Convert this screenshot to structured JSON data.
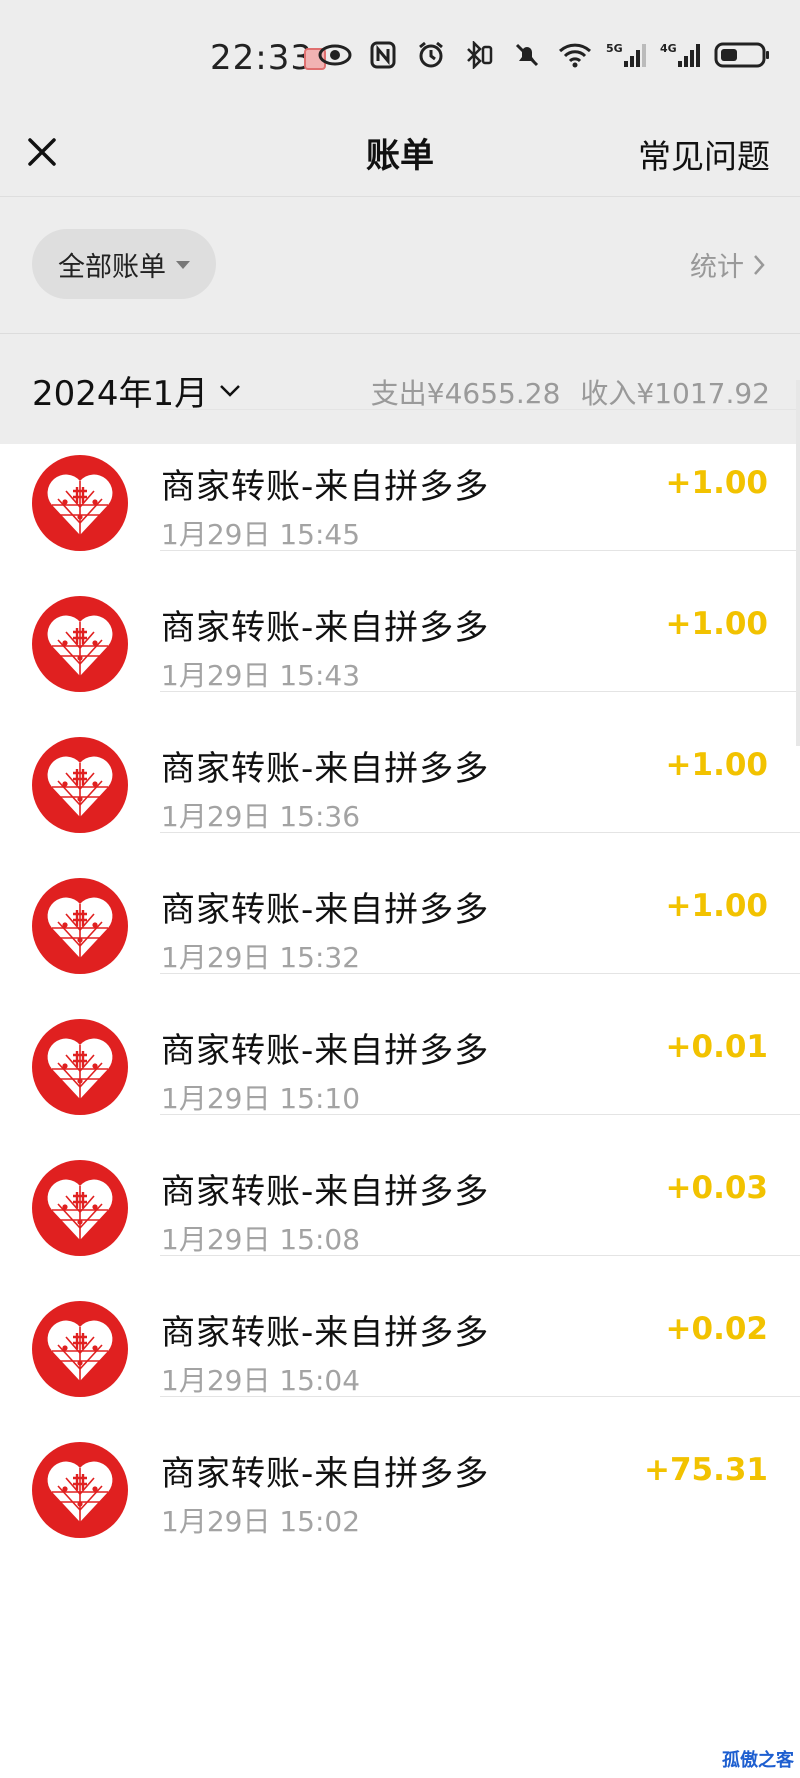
{
  "status_bar": {
    "time": "22:33",
    "icons": [
      "screen-record-icon",
      "eye-icon",
      "nfc-icon",
      "alarm-icon",
      "bluetooth-icon",
      "mute-icon",
      "wifi-icon",
      "signal-5g-icon",
      "signal-4g-icon",
      "battery-icon"
    ],
    "network_5g": "5G",
    "network_4g": "4G"
  },
  "navbar": {
    "title": "账单",
    "faq_label": "常见问题"
  },
  "filter": {
    "label": "全部账单",
    "stats_label": "统计"
  },
  "month": {
    "label": "2024年1月",
    "expense": "支出¥4655.28",
    "income": "收入¥1017.92"
  },
  "transactions": [
    {
      "name": "商家转账-来自拼多多",
      "time": "1月29日 15:45",
      "amount": "+1.00"
    },
    {
      "name": "商家转账-来自拼多多",
      "time": "1月29日 15:43",
      "amount": "+1.00"
    },
    {
      "name": "商家转账-来自拼多多",
      "time": "1月29日 15:36",
      "amount": "+1.00"
    },
    {
      "name": "商家转账-来自拼多多",
      "time": "1月29日 15:32",
      "amount": "+1.00"
    },
    {
      "name": "商家转账-来自拼多多",
      "time": "1月29日 15:10",
      "amount": "+0.01"
    },
    {
      "name": "商家转账-来自拼多多",
      "time": "1月29日 15:08",
      "amount": "+0.03"
    },
    {
      "name": "商家转账-来自拼多多",
      "time": "1月29日 15:04",
      "amount": "+0.02"
    },
    {
      "name": "商家转账-来自拼多多",
      "time": "1月29日 15:02",
      "amount": "+75.31"
    }
  ],
  "watermark": "孤傲之客",
  "colors": {
    "income_amount": "#f2c200",
    "brand_red": "#e02020"
  }
}
